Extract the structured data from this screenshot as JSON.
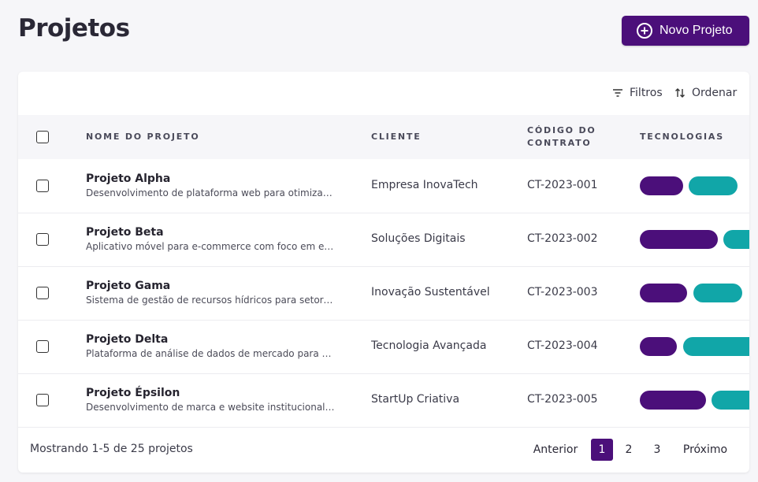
{
  "header": {
    "title": "Projetos",
    "new_button_label": "Novo Projeto"
  },
  "toolbar": {
    "filters_label": "Filtros",
    "sort_label": "Ordenar"
  },
  "table": {
    "columns": [
      "Nome do Projeto",
      "Cliente",
      "Código do Contrato",
      "Tecnologias"
    ],
    "rows": [
      {
        "name": "Projeto Alpha",
        "description": "Desenvolvimento de plataforma web para otimização de processos",
        "client": "Empresa InovaTech",
        "code": "CT-2023-001"
      },
      {
        "name": "Projeto Beta",
        "description": "Aplicativo móvel para e-commerce com foco em experiência do usuário",
        "client": "Soluções Digitais",
        "code": "CT-2023-002"
      },
      {
        "name": "Projeto Gama",
        "description": "Sistema de gestão de recursos hídricos para setores industriais",
        "client": "Inovação Sustentável",
        "code": "CT-2023-003"
      },
      {
        "name": "Projeto Delta",
        "description": "Plataforma de análise de dados de mercado para tomada de decisão",
        "client": "Tecnologia Avançada",
        "code": "CT-2023-004"
      },
      {
        "name": "Projeto Épsilon",
        "description": "Desenvolvimento de marca e website institucional completo",
        "client": "StartUp Criativa",
        "code": "CT-2023-005"
      }
    ]
  },
  "pagination": {
    "info": "Mostrando 1-5 de 25 projetos",
    "previous": "Anterior",
    "pages": [
      "1",
      "2",
      "3"
    ],
    "next": "Próximo",
    "current": "1"
  },
  "colors": {
    "primary": "#4b0f7a",
    "secondary": "#11a6a8",
    "background": "#f6f6f9"
  }
}
